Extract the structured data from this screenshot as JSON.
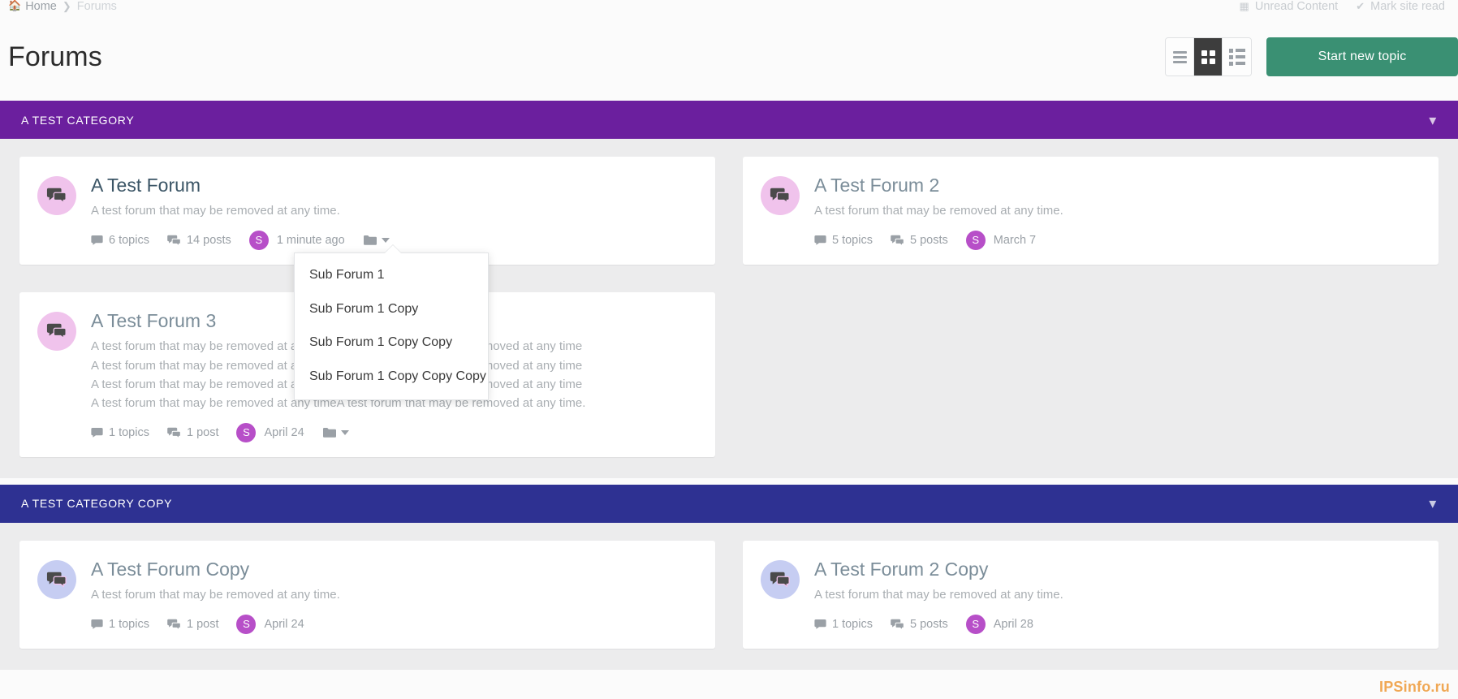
{
  "breadcrumb": {
    "home_icon": "home-icon",
    "home": "Home",
    "separator": "❯",
    "current": "Forums"
  },
  "topnav": {
    "unread_icon": "unread-content-icon",
    "unread": "Unread Content",
    "check_icon": "check-icon",
    "mark_read": "Mark site read"
  },
  "header": {
    "title": "Forums",
    "view_list_icon": "view-rows-icon",
    "view_grid_icon": "view-grid-icon",
    "view_table_icon": "view-list-icon",
    "active_view": "grid",
    "new_topic_label": "Start new topic",
    "accent_color": "#3a9073"
  },
  "categories": [
    {
      "name": "A TEST CATEGORY",
      "color": "#6b1f9e",
      "collapse_icon": "chevron-down-icon",
      "forums": [
        {
          "title": "A Test Forum",
          "avatar_color": "#f0c3ec",
          "icon": "speech-bubble-icon",
          "description_lines": [
            "A test forum that may be removed at any time."
          ],
          "topics": "6 topics",
          "posts": "14 posts",
          "last_user_initial": "S",
          "last_post": "1 minute ago",
          "has_subforums": true,
          "muted": false
        },
        {
          "title": "A Test Forum 2",
          "avatar_color": "#f0c3ec",
          "icon": "speech-bubble-icon",
          "description_lines": [
            "A test forum that may be removed at any time."
          ],
          "topics": "5 topics",
          "posts": "5 posts",
          "last_user_initial": "S",
          "last_post": "March 7",
          "has_subforums": false,
          "muted": true
        },
        {
          "title": "A Test Forum 3",
          "avatar_color": "#f0c3ec",
          "icon": "speech-bubble-icon",
          "description_lines": [
            "A test forum that may be removed at any timeA test forum that may be removed at any time",
            "A test forum that may be removed at any timeA test forum that may be removed at any time",
            "A test forum that may be removed at any timeA test forum that may be removed at any time",
            "A test forum that may be removed at any timeA test forum that may be removed at any time."
          ],
          "topics": "1 topics",
          "posts": "1 post",
          "last_user_initial": "S",
          "last_post": "April 24",
          "has_subforums": true,
          "muted": true
        }
      ]
    },
    {
      "name": "A TEST CATEGORY COPY",
      "color": "#2e3192",
      "collapse_icon": "chevron-down-icon",
      "forums": [
        {
          "title": "A Test Forum Copy",
          "avatar_color": "#c6cdf2",
          "icon": "speech-bubble-icon",
          "description_lines": [
            "A test forum that may be removed at any time."
          ],
          "topics": "1 topics",
          "posts": "1 post",
          "last_user_initial": "S",
          "last_post": "April 24",
          "has_subforums": false,
          "muted": true
        },
        {
          "title": "A Test Forum 2 Copy",
          "avatar_color": "#c6cdf2",
          "icon": "speech-bubble-icon",
          "description_lines": [
            "A test forum that may be removed at any time."
          ],
          "topics": "1 topics",
          "posts": "5 posts",
          "last_user_initial": "S",
          "last_post": "April 28",
          "has_subforums": false,
          "muted": true
        }
      ]
    }
  ],
  "subforum_dropdown": {
    "open": true,
    "items": [
      "Sub Forum 1",
      "Sub Forum 1 Copy",
      "Sub Forum 1 Copy Copy",
      "Sub Forum 1 Copy Copy Copy"
    ]
  },
  "watermark": "IPSinfo.ru"
}
